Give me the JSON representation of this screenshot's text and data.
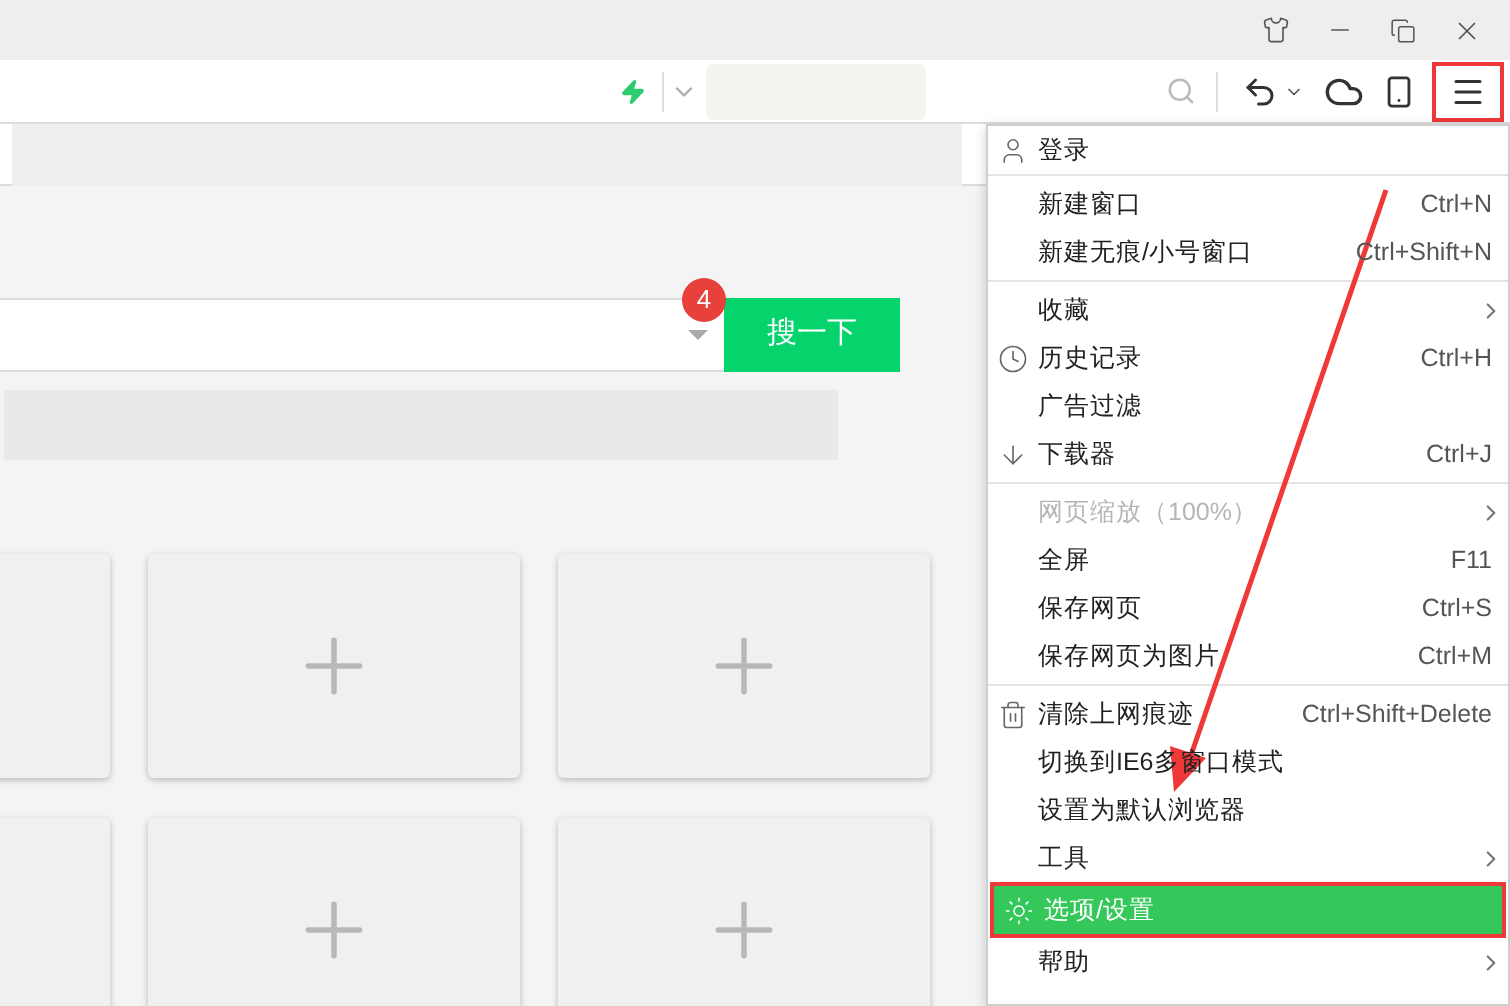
{
  "search": {
    "button": "搜一下",
    "badge": "4"
  },
  "menu": {
    "sections": [
      [
        {
          "label": "登录",
          "submenu": false,
          "disabled": false,
          "selected": false
        }
      ],
      [
        {
          "label": "新建窗口",
          "shortcut": "Ctrl+N",
          "submenu": false,
          "disabled": false,
          "selected": false
        },
        {
          "label": "新建无痕/小号窗口",
          "shortcut": "Ctrl+Shift+N",
          "submenu": false,
          "disabled": false,
          "selected": false
        }
      ],
      [
        {
          "label": "收藏",
          "submenu": true,
          "disabled": false,
          "selected": false
        },
        {
          "label": "历史记录",
          "shortcut": "Ctrl+H",
          "submenu": false,
          "disabled": false,
          "selected": false
        },
        {
          "label": "广告过滤",
          "submenu": false,
          "disabled": false,
          "selected": false
        },
        {
          "label": "下载器",
          "shortcut": "Ctrl+J",
          "submenu": false,
          "disabled": false,
          "selected": false
        }
      ],
      [
        {
          "label": "网页缩放（100%）",
          "submenu": true,
          "disabled": true,
          "selected": false
        },
        {
          "label": "全屏",
          "shortcut": "F11",
          "submenu": false,
          "disabled": false,
          "selected": false
        },
        {
          "label": "保存网页",
          "shortcut": "Ctrl+S",
          "submenu": false,
          "disabled": false,
          "selected": false
        },
        {
          "label": "保存网页为图片",
          "shortcut": "Ctrl+M",
          "submenu": false,
          "disabled": false,
          "selected": false
        }
      ],
      [
        {
          "label": "清除上网痕迹",
          "shortcut": "Ctrl+Shift+Delete",
          "submenu": false,
          "disabled": false,
          "selected": false
        },
        {
          "label": "切换到IE6多窗口模式",
          "submenu": false,
          "disabled": false,
          "selected": false
        },
        {
          "label": "设置为默认浏览器",
          "submenu": false,
          "disabled": false,
          "selected": false
        },
        {
          "label": "工具",
          "submenu": true,
          "disabled": false,
          "selected": false
        },
        {
          "label": "选项/设置",
          "submenu": false,
          "disabled": false,
          "selected": true
        },
        {
          "label": "帮助",
          "submenu": true,
          "disabled": false,
          "selected": false
        }
      ]
    ]
  }
}
